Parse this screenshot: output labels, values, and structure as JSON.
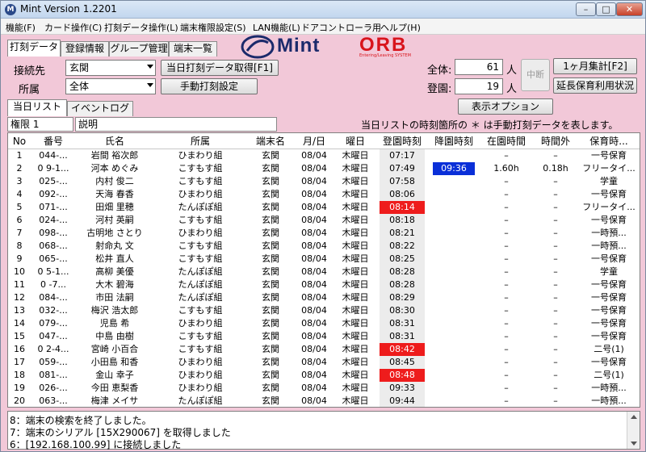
{
  "window": {
    "title": "Mint Version 1.2201",
    "min": "–",
    "max": "□",
    "close": "✕"
  },
  "menu": [
    "機能(F)",
    "カード操作(C)",
    "打刻データ操作(L)",
    "端末権限設定(S)",
    "LAN機能(L)",
    "ドアコントローラ用",
    "ヘルプ(H)"
  ],
  "top_tabs": [
    "打刻データ",
    "登録情報",
    "グループ管理",
    "端末一覧"
  ],
  "logo": {
    "mint": "Mint",
    "orb": "ORB",
    "tagline": "Entering/Leaving SYSTEM"
  },
  "form": {
    "connect_label": "接続先",
    "connect_value": "玄関",
    "affiliation_label": "所属",
    "affiliation_value": "全体",
    "fetch_button": "当日打刻データ取得[F1]",
    "manual_button": "手動打刻設定",
    "total_label": "全体:",
    "total_value": "61",
    "total_unit": "人",
    "present_label": "登園:",
    "present_value": "19",
    "present_unit": "人",
    "abort_button": "中断",
    "monthly_button": "1ヶ月集計[F2]",
    "extended_button": "延長保育利用状況",
    "display_option_button": "表示オプション",
    "note": "当日リストの時刻箇所の ＊ は手動打刻データを表します。"
  },
  "mid_tabs": [
    "当日リスト",
    "イベントログ"
  ],
  "auth_box": "権限 1",
  "desc_box": "説明",
  "grid": {
    "headers": [
      "No",
      "番号",
      "氏名",
      "所属",
      "端末名",
      "月/日",
      "曜日",
      "登園時刻",
      "降園時刻",
      "在園時間",
      "時間外",
      "保育時..."
    ],
    "rows": [
      [
        "1",
        "044-...",
        "岩間 裕次郎",
        "ひまわり組",
        "玄関",
        "08/04",
        "木曜日",
        "07:17",
        "",
        "–",
        "–",
        "一号保育"
      ],
      [
        "2",
        "0 9-1...",
        "河本 めぐみ",
        "こすもす組",
        "玄関",
        "08/04",
        "木曜日",
        "07:49",
        "09:36",
        "1.60h",
        "0.18h",
        "フリータイ..."
      ],
      [
        "3",
        "025-...",
        "内村 俊二",
        "こすもす組",
        "玄関",
        "08/04",
        "木曜日",
        "07:58",
        "",
        "–",
        "–",
        "学童"
      ],
      [
        "4",
        "092-...",
        "天海 春香",
        "ひまわり組",
        "玄関",
        "08/04",
        "木曜日",
        "08:06",
        "",
        "–",
        "–",
        "一号保育"
      ],
      [
        "5",
        "071-...",
        "田畑 里穂",
        "たんぽぽ組",
        "玄関",
        "08/04",
        "木曜日",
        "08:14",
        "",
        "–",
        "–",
        "フリータイ..."
      ],
      [
        "6",
        "024-...",
        "河村 英嗣",
        "こすもす組",
        "玄関",
        "08/04",
        "木曜日",
        "08:18",
        "",
        "–",
        "–",
        "一号保育"
      ],
      [
        "7",
        "098-...",
        "古明地 さとり",
        "ひまわり組",
        "玄関",
        "08/04",
        "木曜日",
        "08:21",
        "",
        "–",
        "–",
        "一時預..."
      ],
      [
        "8",
        "068-...",
        "射命丸 文",
        "こすもす組",
        "玄関",
        "08/04",
        "木曜日",
        "08:22",
        "",
        "–",
        "–",
        "一時預..."
      ],
      [
        "9",
        "065-...",
        "松井 直人",
        "こすもす組",
        "玄関",
        "08/04",
        "木曜日",
        "08:25",
        "",
        "–",
        "–",
        "一号保育"
      ],
      [
        "10",
        "0 5-1...",
        "高柳 美優",
        "たんぽぽ組",
        "玄関",
        "08/04",
        "木曜日",
        "08:28",
        "",
        "–",
        "–",
        "学童"
      ],
      [
        "11",
        "0 -7...",
        "大木 碧海",
        "たんぽぽ組",
        "玄関",
        "08/04",
        "木曜日",
        "08:28",
        "",
        "–",
        "–",
        "一号保育"
      ],
      [
        "12",
        "084-...",
        "市田 法嗣",
        "たんぽぽ組",
        "玄関",
        "08/04",
        "木曜日",
        "08:29",
        "",
        "–",
        "–",
        "一号保育"
      ],
      [
        "13",
        "032-...",
        "梅沢 浩太郎",
        "こすもす組",
        "玄関",
        "08/04",
        "木曜日",
        "08:30",
        "",
        "–",
        "–",
        "一号保育"
      ],
      [
        "14",
        "079-...",
        "児島 希",
        "ひまわり組",
        "玄関",
        "08/04",
        "木曜日",
        "08:31",
        "",
        "–",
        "–",
        "一号保育"
      ],
      [
        "15",
        "047-...",
        "中島 由樹",
        "こすもす組",
        "玄関",
        "08/04",
        "木曜日",
        "08:31",
        "",
        "–",
        "–",
        "一号保育"
      ],
      [
        "16",
        "0 2-4...",
        "宮崎 小百合",
        "こすもす組",
        "玄関",
        "08/04",
        "木曜日",
        "08:42",
        "",
        "–",
        "–",
        "二号(1)"
      ],
      [
        "17",
        "059-...",
        "小田島 和香",
        "ひまわり組",
        "玄関",
        "08/04",
        "木曜日",
        "08:45",
        "",
        "–",
        "–",
        "一号保育"
      ],
      [
        "18",
        "081-...",
        "金山 幸子",
        "ひまわり組",
        "玄関",
        "08/04",
        "木曜日",
        "08:48",
        "",
        "–",
        "–",
        "二号(1)"
      ],
      [
        "19",
        "026-...",
        "今田 恵梨香",
        "ひまわり組",
        "玄関",
        "08/04",
        "木曜日",
        "09:33",
        "",
        "–",
        "–",
        "一時預..."
      ],
      [
        "20",
        "063-...",
        "梅津 メイサ",
        "たんぽぽ組",
        "玄関",
        "08/04",
        "木曜日",
        "09:44",
        "",
        "–",
        "–",
        "一時預..."
      ]
    ],
    "red_arrival_rows": [
      5,
      16,
      18
    ],
    "blue_leave_rows": [
      2
    ]
  },
  "log": [
    "8：端末の検索を終了しました。",
    "7：端末のシリアル [15X290067] を取得しました",
    "6：[192.168.100.99] に接続しました"
  ],
  "colors": {
    "window_bg": "#f2c8d8",
    "late_red": "#ee1c1c",
    "leave_blue": "#0a2fd8",
    "brand_navy": "#1b2a6b",
    "brand_red": "#d8141c"
  }
}
